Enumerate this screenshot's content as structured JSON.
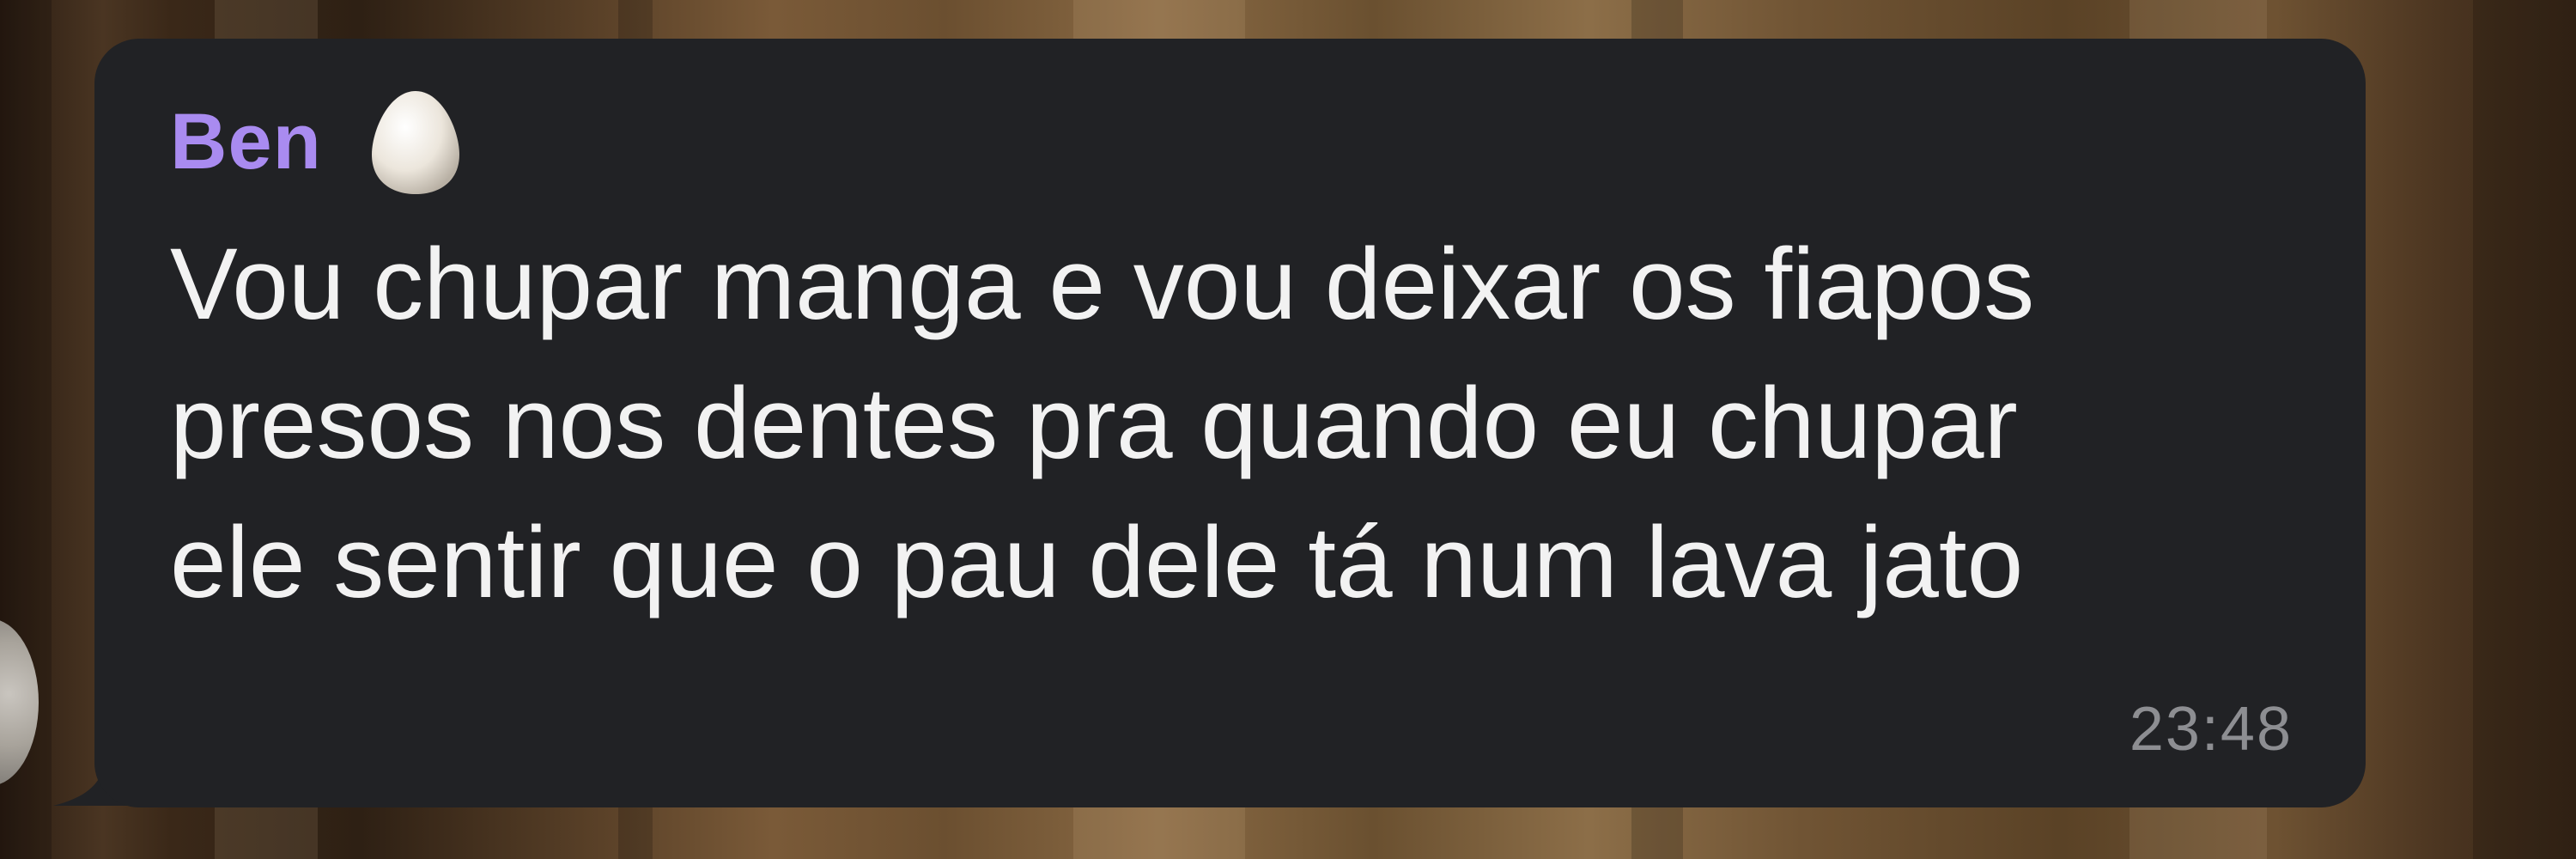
{
  "message": {
    "sender": {
      "name": "Ben",
      "emoji": "egg-emoji"
    },
    "text": "Vou chupar manga e vou deixar os fiapos\npresos nos dentes pra quando eu chupar\nele sentir que o pau dele tá num lava jato",
    "time": "23:48"
  },
  "colors": {
    "bubble": "#212225",
    "sender_name": "#a98bf0",
    "message_text": "#f2f2f2",
    "timestamp": "#8d8e92"
  }
}
